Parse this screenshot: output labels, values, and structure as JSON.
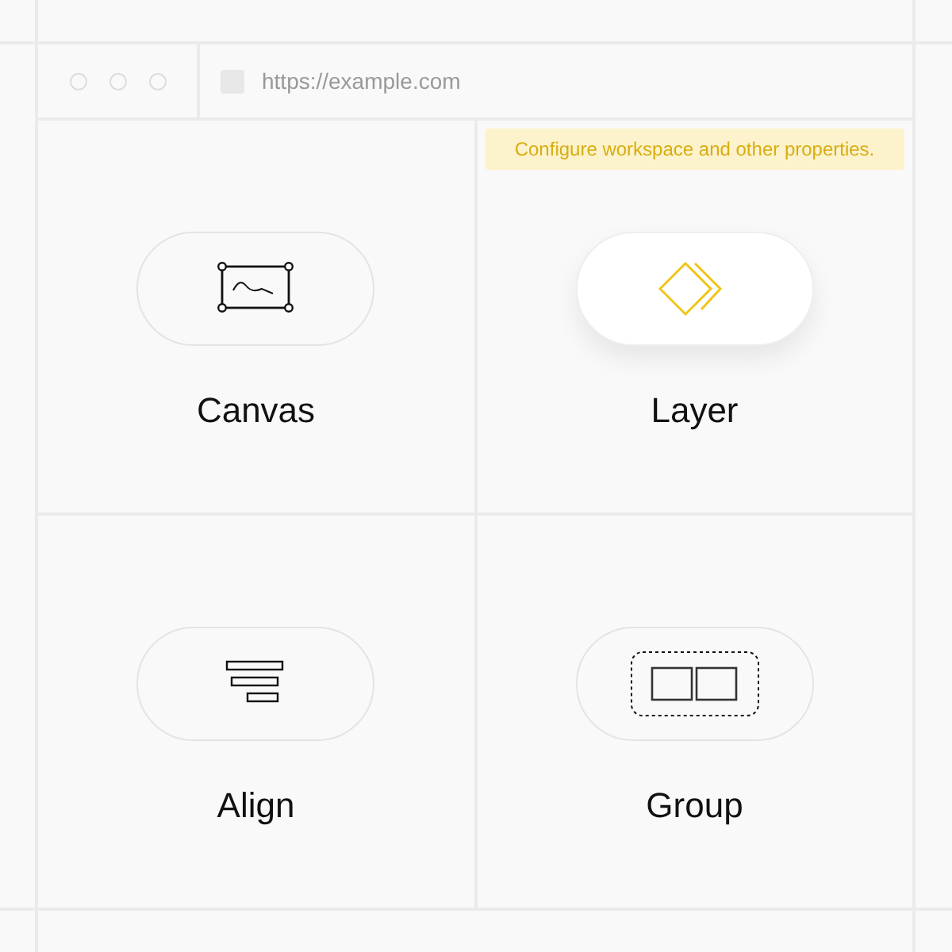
{
  "browser": {
    "url": "https://example.com"
  },
  "tooltip": {
    "text": "Configure workspace and other properties."
  },
  "tiles": [
    {
      "kind": "canvas",
      "label": "Canvas",
      "selected": false
    },
    {
      "kind": "layer",
      "label": "Layer",
      "selected": true
    },
    {
      "kind": "align",
      "label": "Align",
      "selected": false
    },
    {
      "kind": "group",
      "label": "Group",
      "selected": false
    }
  ]
}
